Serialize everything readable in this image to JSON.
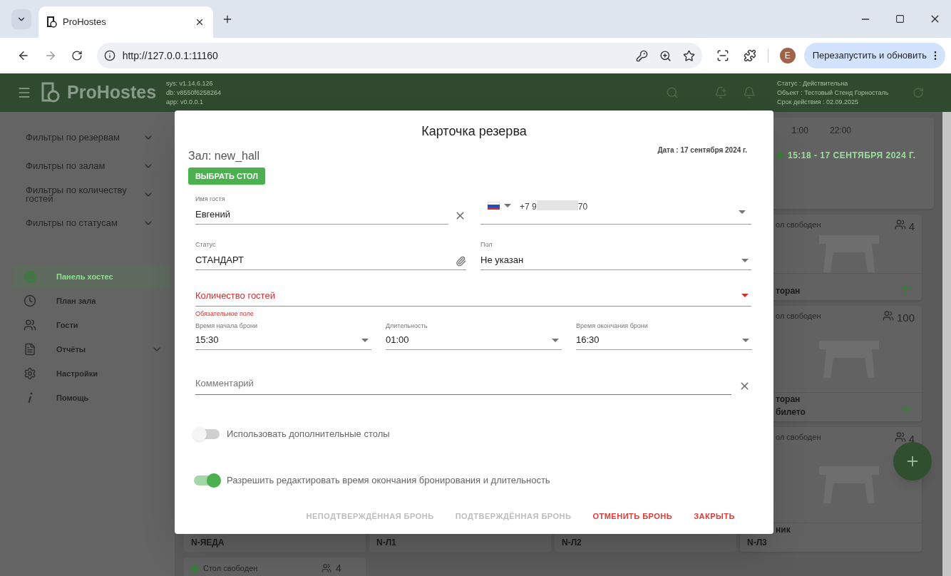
{
  "browser": {
    "tab_title": "ProHostes",
    "url": "http://127.0.0.1:11160",
    "profile_initial": "E",
    "update_button": "Перезапустить и обновить"
  },
  "app_header": {
    "logo": "ProHostes",
    "versions": [
      "sys: v1.14.6.126",
      "db: v8550f6258264",
      "app: v0.0.0.1"
    ],
    "license": [
      "Статус : Действительна",
      "Объект : Тестовый Стенд Горносталь",
      "Срок действия : 02.09.2025"
    ]
  },
  "sidebar": {
    "filters": [
      "Фильтры по резервам",
      "Фильтры по залам",
      "Фильтры по количеству гостей",
      "Фильтры по статусам"
    ],
    "nav": [
      {
        "label": "Панель хостес",
        "kind": "clock",
        "selected": true,
        "expandable": false
      },
      {
        "label": "План зала",
        "kind": "plan",
        "selected": false,
        "expandable": false
      },
      {
        "label": "Гости",
        "kind": "guests",
        "selected": false,
        "expandable": false
      },
      {
        "label": "Отчёты",
        "kind": "reports",
        "selected": false,
        "expandable": true
      },
      {
        "label": "Настройки",
        "kind": "settings",
        "selected": false,
        "expandable": false
      },
      {
        "label": "Помощь",
        "kind": "help",
        "selected": false,
        "expandable": false
      }
    ]
  },
  "background": {
    "timeline": {
      "times": [
        "1:00",
        "22:00"
      ],
      "current": "15:18 - 17 СЕНТЯБРЯ 2024 Г."
    },
    "tables_column": [
      {
        "status": "ол свободен",
        "capacity": "4",
        "title_lines": [
          "торан"
        ]
      },
      {
        "status": "ол свободен",
        "capacity": "100",
        "title_lines": [
          "торан",
          "билето"
        ]
      },
      {
        "status": "ол свободен",
        "capacity": "4",
        "title_lines": [
          "ник"
        ],
        "code": "N-Л3"
      }
    ],
    "bottom_codes": [
      "N-ЯЕДА",
      "N-Л1",
      "N-Л2"
    ],
    "next_row": {
      "status": "Стол свободен",
      "capacity": "4"
    }
  },
  "dialog": {
    "title": "Карточка резерва",
    "hall": "Зал: new_hall",
    "date": "Дата : 17 сентября 2024 г.",
    "choose_table_button": "ВЫБРАТЬ СТОЛ",
    "guest_name": {
      "label": "Имя гостя",
      "value": "Евгений"
    },
    "phone": {
      "prefix": "+7 9",
      "suffix": "70"
    },
    "status": {
      "label": "Статус",
      "value": "СТАНДАРТ"
    },
    "gender": {
      "label": "Пол",
      "value": "Не указан"
    },
    "guest_count": {
      "placeholder": "Количество гостей",
      "error": "Обязательное поле"
    },
    "times": [
      {
        "label": "Время начала брони",
        "value": "15:30"
      },
      {
        "label": "Длительность",
        "value": "01:00"
      },
      {
        "label": "Время окончания брони",
        "value": "16:30"
      }
    ],
    "comment": {
      "placeholder": "Комментарий"
    },
    "toggles": [
      {
        "label": "Использовать дополнительные столы",
        "on": false
      },
      {
        "label": "Разрешить редактировать время окончания бронирования и длительность",
        "on": true
      }
    ],
    "actions": [
      {
        "label": "НЕПОДТВЕРЖДЁННАЯ БРОНЬ",
        "disabled": true
      },
      {
        "label": "ПОДТВЕРЖДЁННАЯ БРОНЬ",
        "disabled": true
      },
      {
        "label": "ОТМЕНИТЬ БРОНЬ",
        "disabled": false
      },
      {
        "label": "ЗАКРЫТЬ",
        "disabled": false
      }
    ]
  }
}
